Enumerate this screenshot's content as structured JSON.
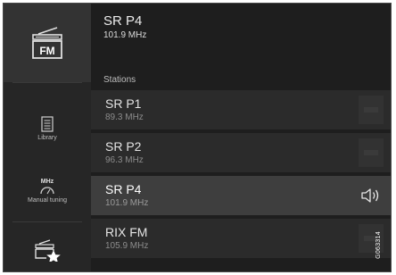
{
  "sidebar": {
    "fm_label": "FM",
    "library_label": "Library",
    "mhz_label": "MHz",
    "manual_label": "Manual tuning"
  },
  "now_playing": {
    "name": "SR P4",
    "frequency": "101.9 MHz"
  },
  "stations_header": "Stations",
  "stations": [
    {
      "name": "SR P1",
      "frequency": "89.3 MHz",
      "active": false
    },
    {
      "name": "SR P2",
      "frequency": "96.3 MHz",
      "active": false
    },
    {
      "name": "SR P4",
      "frequency": "101.9 MHz",
      "active": true
    },
    {
      "name": "RIX FM",
      "frequency": "105.9 MHz",
      "active": false
    }
  ],
  "image_code": "G063314",
  "colors": {
    "background": "#1f1f1f",
    "active_row": "#3e3e3e",
    "row": "#2b2b2b"
  }
}
